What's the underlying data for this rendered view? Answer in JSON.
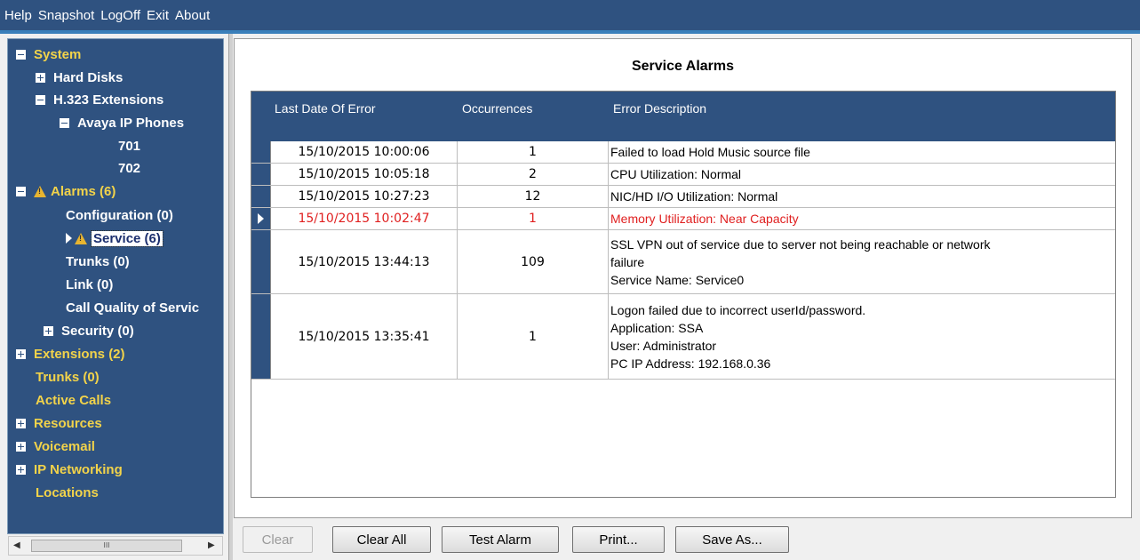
{
  "menu": {
    "items": [
      "Help",
      "Snapshot",
      "LogOff",
      "Exit",
      "About"
    ]
  },
  "tree": {
    "nodes": [
      {
        "label": "System",
        "expander": "minus"
      },
      {
        "label": "Hard Disks",
        "expander": "plus"
      },
      {
        "label": "H.323 Extensions",
        "expander": "minus"
      },
      {
        "label": "Avaya IP Phones",
        "expander": "minus"
      },
      {
        "label": "701"
      },
      {
        "label": "702"
      },
      {
        "label": "Alarms (6)",
        "expander": "minus",
        "icon": "warning-icon"
      },
      {
        "label": "Configuration (0)"
      },
      {
        "label": "Service (6)",
        "icon": "warning-icon",
        "selected": true
      },
      {
        "label": "Trunks (0)"
      },
      {
        "label": "Link (0)"
      },
      {
        "label": "Call Quality of Servic"
      },
      {
        "label": "Security (0)",
        "expander": "plus"
      },
      {
        "label": "Extensions (2)",
        "expander": "plus"
      },
      {
        "label": "Trunks (0)"
      },
      {
        "label": "Active Calls"
      },
      {
        "label": "Resources",
        "expander": "plus"
      },
      {
        "label": "Voicemail",
        "expander": "plus"
      },
      {
        "label": "IP Networking",
        "expander": "plus"
      },
      {
        "label": "Locations"
      }
    ],
    "scroll_thumb_glyph": "III"
  },
  "panel": {
    "title": "Service Alarms"
  },
  "grid": {
    "columns": [
      "Last Date Of Error",
      "Occurrences",
      "Error Description"
    ],
    "rows": [
      {
        "date": "15/10/2015 10:00:06",
        "occurrences": "1",
        "description": [
          "Failed to load Hold Music source file"
        ]
      },
      {
        "date": "15/10/2015 10:05:18",
        "occurrences": "2",
        "description": [
          "CPU Utilization: Normal"
        ]
      },
      {
        "date": "15/10/2015 10:27:23",
        "occurrences": "12",
        "description": [
          "NIC/HD I/O Utilization: Normal"
        ]
      },
      {
        "date": "15/10/2015 10:02:47",
        "occurrences": "1",
        "description": [
          "Memory Utilization: Near Capacity"
        ],
        "current": true
      },
      {
        "date": "15/10/2015 13:44:13",
        "occurrences": "109",
        "description": [
          "SSL VPN out of service due to server not being reachable or network",
          "failure",
          "Service Name: Service0"
        ]
      },
      {
        "date": "15/10/2015 13:35:41",
        "occurrences": "1",
        "description": [
          "Logon failed due to incorrect userId/password.",
          "Application: SSA",
          "User: Administrator",
          "PC IP Address: 192.168.0.36"
        ]
      }
    ]
  },
  "buttons": {
    "clear": "Clear",
    "clear_all": "Clear All",
    "test_alarm": "Test Alarm",
    "print": "Print...",
    "save_as": "Save As..."
  },
  "colors": {
    "header_blue": "#2f5280",
    "tree_yellow": "#f2d34a",
    "alarm_red": "#e02020"
  }
}
